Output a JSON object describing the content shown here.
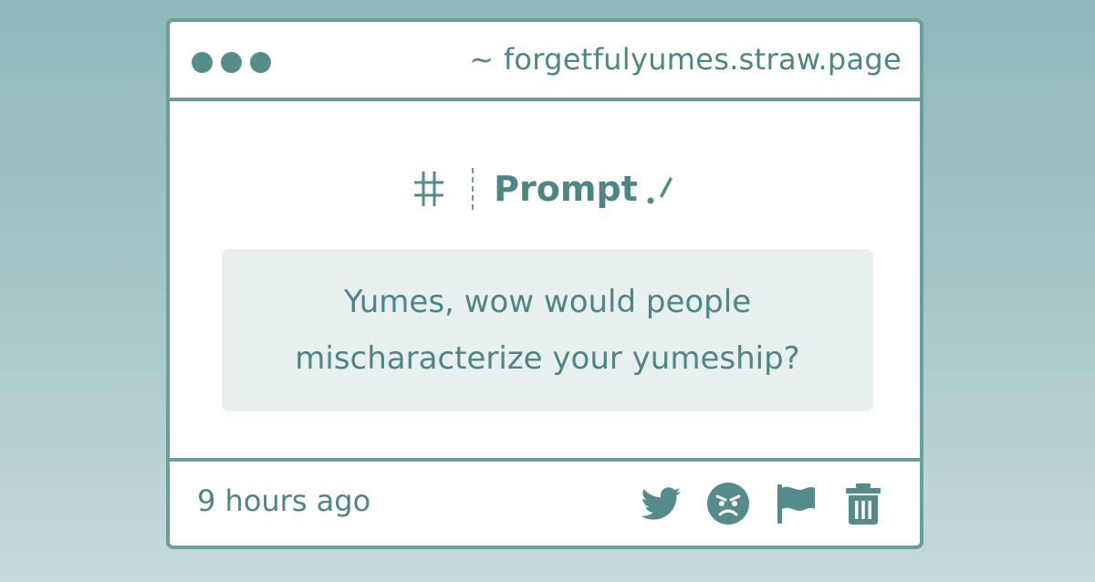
{
  "window": {
    "url": "~ forgetfulyumes.straw.page"
  },
  "post": {
    "heading_symbol": "#",
    "title": "Prompt",
    "question": "Yumes, wow would people mischaracterize your yumeship?",
    "time": "9 hours ago"
  },
  "icons": {
    "window_controls": [
      "dot",
      "dot",
      "dot"
    ],
    "heading": [
      "hash-icon",
      "pen-icon"
    ],
    "actions": [
      "twitter-icon",
      "angry-face-icon",
      "flag-icon",
      "trash-icon"
    ]
  },
  "colors": {
    "accent": "#558b8b",
    "border": "#6d9d9d",
    "prompt_bg": "#e7efef",
    "background_top": "#8fb8b8",
    "background_bottom": "#c6dbdb"
  }
}
